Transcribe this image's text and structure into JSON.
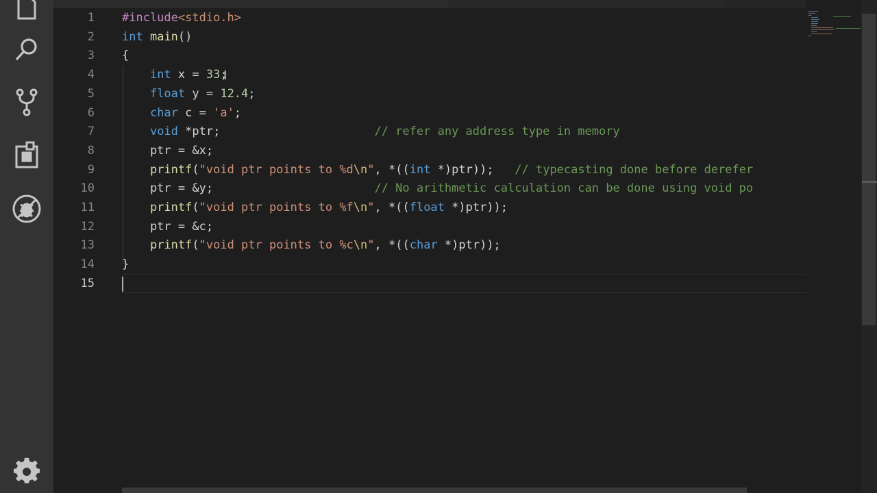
{
  "activity_bar": {
    "items": [
      {
        "name": "explorer-icon"
      },
      {
        "name": "search-icon"
      },
      {
        "name": "source-control-icon"
      },
      {
        "name": "extensions-icon"
      },
      {
        "name": "debug-icon"
      }
    ],
    "bottom": {
      "name": "gear-icon"
    }
  },
  "editor": {
    "active_line": "15",
    "lines": [
      {
        "number": "1",
        "tokens": [
          {
            "t": "#include",
            "c": "pre"
          },
          {
            "t": "<stdio.h>",
            "c": "inc"
          }
        ]
      },
      {
        "number": "2",
        "tokens": [
          {
            "t": "int",
            "c": "kw"
          },
          {
            "t": " "
          },
          {
            "t": "main",
            "c": "fn"
          },
          {
            "t": "()"
          }
        ]
      },
      {
        "number": "3",
        "tokens": [
          {
            "t": "{"
          }
        ]
      },
      {
        "number": "4",
        "tokens": [
          {
            "t": "    "
          },
          {
            "t": "int",
            "c": "kw"
          },
          {
            "t": " x = "
          },
          {
            "t": "33",
            "c": "num"
          },
          {
            "t": ";"
          }
        ]
      },
      {
        "number": "5",
        "tokens": [
          {
            "t": "    "
          },
          {
            "t": "float",
            "c": "kw"
          },
          {
            "t": " y = "
          },
          {
            "t": "12.4",
            "c": "num"
          },
          {
            "t": ";"
          }
        ]
      },
      {
        "number": "6",
        "tokens": [
          {
            "t": "    "
          },
          {
            "t": "char",
            "c": "kw"
          },
          {
            "t": " c = "
          },
          {
            "t": "'a'",
            "c": "str"
          },
          {
            "t": ";"
          }
        ]
      },
      {
        "number": "7",
        "tokens": [
          {
            "t": "    "
          },
          {
            "t": "void",
            "c": "kw"
          },
          {
            "t": " *ptr;                      "
          },
          {
            "t": "// refer any address type in memory",
            "c": "cmt"
          }
        ]
      },
      {
        "number": "8",
        "tokens": [
          {
            "t": "    ptr = &x;"
          }
        ]
      },
      {
        "number": "9",
        "tokens": [
          {
            "t": "    "
          },
          {
            "t": "printf",
            "c": "fn"
          },
          {
            "t": "("
          },
          {
            "t": "\"void ptr points to %d",
            "c": "str"
          },
          {
            "t": "\\n",
            "c": "esc"
          },
          {
            "t": "\"",
            "c": "str"
          },
          {
            "t": ", *(("
          },
          {
            "t": "int",
            "c": "kw"
          },
          {
            "t": " *)ptr));   "
          },
          {
            "t": "// typecasting done before derefer",
            "c": "cmt"
          }
        ]
      },
      {
        "number": "10",
        "tokens": [
          {
            "t": "    ptr = &y;                       "
          },
          {
            "t": "// No arithmetic calculation can be done using void po",
            "c": "cmt"
          }
        ]
      },
      {
        "number": "11",
        "tokens": [
          {
            "t": "    "
          },
          {
            "t": "printf",
            "c": "fn"
          },
          {
            "t": "("
          },
          {
            "t": "\"void ptr points to %f",
            "c": "str"
          },
          {
            "t": "\\n",
            "c": "esc"
          },
          {
            "t": "\"",
            "c": "str"
          },
          {
            "t": ", *(("
          },
          {
            "t": "float",
            "c": "kw"
          },
          {
            "t": " *)ptr));"
          }
        ]
      },
      {
        "number": "12",
        "tokens": [
          {
            "t": "    ptr = &c;"
          }
        ]
      },
      {
        "number": "13",
        "tokens": [
          {
            "t": "    "
          },
          {
            "t": "printf",
            "c": "fn"
          },
          {
            "t": "("
          },
          {
            "t": "\"void ptr points to %c",
            "c": "str"
          },
          {
            "t": "\\n",
            "c": "esc"
          },
          {
            "t": "\"",
            "c": "str"
          },
          {
            "t": ", *(("
          },
          {
            "t": "char",
            "c": "kw"
          },
          {
            "t": " *)ptr));"
          }
        ]
      },
      {
        "number": "14",
        "tokens": [
          {
            "t": "}"
          }
        ]
      },
      {
        "number": "15",
        "tokens": []
      }
    ]
  },
  "colors": {
    "background": "#1e1e1e",
    "activity_bar": "#333333",
    "keyword": "#569cd6",
    "function": "#dcdcaa",
    "string": "#ce9178",
    "number": "#b5cea8",
    "comment": "#6a9955",
    "preprocessor": "#c586c0"
  }
}
